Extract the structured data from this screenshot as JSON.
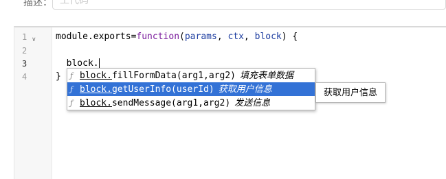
{
  "form": {
    "desc_label": "描述：",
    "desc_placeholder": "工代码"
  },
  "editor": {
    "line_numbers": [
      "1",
      "2",
      "3",
      "4"
    ],
    "fold_icon": "chevron-down-icon",
    "line1": {
      "prefix": "module.exports=",
      "keyword": "function",
      "open": "(",
      "param1": "params",
      "sep1": ", ",
      "param2": "ctx",
      "sep2": ", ",
      "param3": "block",
      "close": ") {"
    },
    "line3": "  block.",
    "line4": "}"
  },
  "autocomplete": {
    "icon_symbol": "ƒ",
    "items": [
      {
        "match": "block.",
        "rest": "fillFormData(arg1,arg2)",
        "description": "填充表单数据",
        "selected": false
      },
      {
        "match": "block.",
        "rest": "getUserInfo(userId)",
        "description": "获取用户信息",
        "selected": true
      },
      {
        "match": "block.",
        "rest": "sendMessage(arg1,arg2)",
        "description": "发送信息",
        "selected": false
      }
    ]
  },
  "tooltip": {
    "text": "获取用户信息"
  },
  "colors": {
    "selection": "#3372d6",
    "keyword": "#7a1a9c",
    "param": "#1d3da0"
  }
}
